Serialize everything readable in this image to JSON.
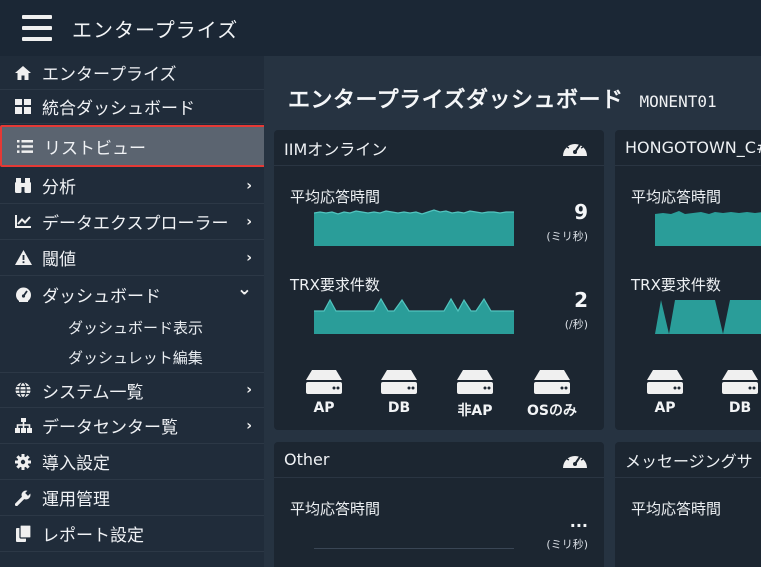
{
  "app": {
    "title": "エンタープライズ"
  },
  "sidebar": {
    "items": [
      {
        "label": "エンタープライズ",
        "icon": "home-icon"
      },
      {
        "label": "統合ダッシュボード",
        "icon": "grid-icon"
      },
      {
        "label": "リストビュー",
        "icon": "list-icon",
        "active": true
      },
      {
        "label": "分析",
        "icon": "binoculars-icon",
        "arrow": "›"
      },
      {
        "label": "データエクスプローラー",
        "icon": "chart-icon",
        "arrow": "›"
      },
      {
        "label": "閾値",
        "icon": "warning-icon",
        "arrow": "›"
      },
      {
        "label": "ダッシュボード",
        "icon": "gauge-icon",
        "arrow": "⌄"
      },
      {
        "label": "システム一覧",
        "icon": "globe-icon",
        "arrow": "›"
      },
      {
        "label": "データセンター覧",
        "icon": "sitemap-icon",
        "arrow": "›"
      },
      {
        "label": "導入設定",
        "icon": "gear-icon"
      },
      {
        "label": "運用管理",
        "icon": "wrench-icon"
      },
      {
        "label": "レポート設定",
        "icon": "copy-icon"
      }
    ],
    "subitems": [
      "ダッシュボード表示",
      "ダッシュレット編集"
    ]
  },
  "main": {
    "title": "エンタープライズダッシュボード",
    "subtitle": "MONENT01",
    "panels": [
      {
        "title": "IIMオンライン",
        "metrics": [
          {
            "label": "平均応答時間",
            "value": "9",
            "unit": "(ミリ秒)"
          },
          {
            "label": "TRX要求件数",
            "value": "2",
            "unit": "(/秒)"
          }
        ],
        "servers": [
          "AP",
          "DB",
          "非AP",
          "OSのみ"
        ]
      },
      {
        "title": "HONGOTOWN_C#",
        "metrics": [
          {
            "label": "平均応答時間"
          },
          {
            "label": "TRX要求件数"
          }
        ],
        "servers": [
          "AP",
          "DB"
        ]
      },
      {
        "title": "Other",
        "metrics": [
          {
            "label": "平均応答時間",
            "value": "...",
            "unit": "(ミリ秒)"
          }
        ]
      },
      {
        "title": "メッセージングサ",
        "metrics": [
          {
            "label": "平均応答時間"
          }
        ]
      }
    ]
  },
  "colors": {
    "accent": "#2a9d99",
    "active_border": "#e53935",
    "sidebar_bg": "#202c3a",
    "panel_bg": "#1c2631"
  }
}
